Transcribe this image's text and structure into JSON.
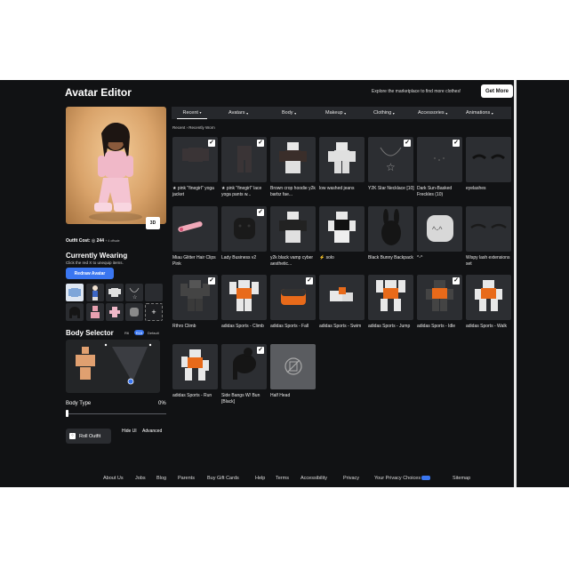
{
  "header": {
    "title": "Avatar Editor",
    "promo_text": "Explore the marketplace to find more clothes!",
    "get_more_label": "Get More"
  },
  "preview": {
    "button_3d_label": "3D",
    "outfit_cost_label": "Outfit Cost:",
    "outfit_cost_value": "244",
    "outfit_cost_suffix": "+ 4 offsale"
  },
  "currently_wearing": {
    "title": "Currently Wearing",
    "help_text": "Click the red X to unequip items.",
    "redraw_label": "Redraw Avatar",
    "add_icon": "+"
  },
  "body_selector": {
    "title": "Body Selector",
    "rig_r6_label": "R6",
    "rig_r15_label": "R15",
    "custom_label": "Default",
    "body_type_label": "Body Type",
    "body_type_value": "0%",
    "body_type_fraction": 0.0
  },
  "controls": {
    "roll_outfit_label": "Roll Outfit",
    "hide_ui_label": "Hide UI",
    "advanced_label": "Advanced"
  },
  "tabs": [
    {
      "label": "Recent",
      "active": true
    },
    {
      "label": "Avatars",
      "active": false
    },
    {
      "label": "Body",
      "active": false
    },
    {
      "label": "Makeup",
      "active": false
    },
    {
      "label": "Clothing",
      "active": false
    },
    {
      "label": "Accessories",
      "active": false
    },
    {
      "label": "Animations",
      "active": false
    }
  ],
  "breadcrumb": {
    "root": "Recent",
    "sep": "›",
    "current": "Recently Worn"
  },
  "items": [
    {
      "name": "★ pink \"finegirl\" yoga jacket",
      "checked": true
    },
    {
      "name": "★ pink \"finegirl\" lace yoga pants w...",
      "checked": true
    },
    {
      "name": "Brown crop hoodie y2k barbz fae...",
      "checked": false
    },
    {
      "name": "low washed jeans",
      "checked": false
    },
    {
      "name": "Y2K Star Necklace [10]",
      "checked": true
    },
    {
      "name": "Dark Sun-Basked Freckles (10)",
      "checked": true
    },
    {
      "name": "eyelashes",
      "checked": false
    },
    {
      "name": "Miau Glitter Hair Clips Pink",
      "checked": false
    },
    {
      "name": "Lady Business v2",
      "checked": true
    },
    {
      "name": "y2k black vamp cyber aesthetic...",
      "checked": false
    },
    {
      "name": "⚡ solo",
      "checked": false
    },
    {
      "name": "Black Bunny Backpack",
      "checked": false
    },
    {
      "name": "^-^",
      "checked": false
    },
    {
      "name": "Wispy lash extensions set",
      "checked": false
    },
    {
      "name": "Rthro Climb",
      "checked": true
    },
    {
      "name": "adidas Sports - Climb",
      "checked": false
    },
    {
      "name": "adidas Sports - Fall",
      "checked": true
    },
    {
      "name": "adidas Sports - Swim",
      "checked": false
    },
    {
      "name": "adidas Sports - Jump",
      "checked": false
    },
    {
      "name": "adidas Sports - Idle",
      "checked": true
    },
    {
      "name": "adidas Sports - Walk",
      "checked": false
    },
    {
      "name": "adidas Sports - Run",
      "checked": false
    },
    {
      "name": "Side Bangs W/ Bun [Black]",
      "checked": true
    },
    {
      "name": "Half Head",
      "checked": false
    }
  ],
  "footer": {
    "links": [
      "About Us",
      "Jobs",
      "Blog",
      "Parents",
      "Buy Gift Cards",
      "Help",
      "Terms",
      "Accessibility",
      "Privacy",
      "Your Privacy Choices",
      "Sitemap"
    ]
  },
  "colors": {
    "background": "#111214",
    "accent": "#3a76f0",
    "tile": "#2c2e32"
  }
}
